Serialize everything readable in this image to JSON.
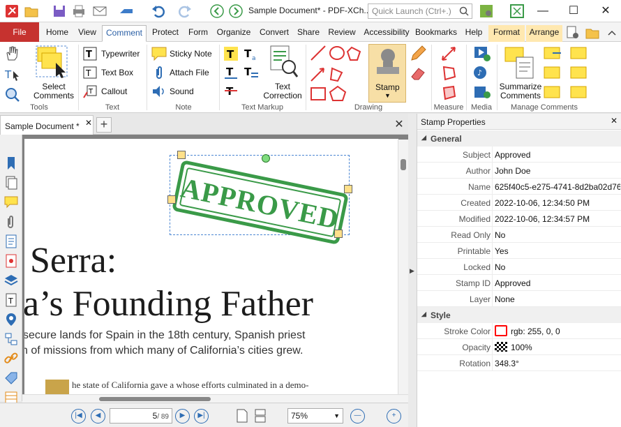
{
  "window": {
    "title": "Sample Document* - PDF-XCh...",
    "quick_launch_placeholder": "Quick Launch (Ctrl+.)"
  },
  "tabs": [
    {
      "label": "File"
    },
    {
      "label": "Home"
    },
    {
      "label": "View"
    },
    {
      "label": "Comment"
    },
    {
      "label": "Protect"
    },
    {
      "label": "Form"
    },
    {
      "label": "Organize"
    },
    {
      "label": "Convert"
    },
    {
      "label": "Share"
    },
    {
      "label": "Review"
    },
    {
      "label": "Accessibility"
    },
    {
      "label": "Bookmarks"
    },
    {
      "label": "Help"
    },
    {
      "label": "Format"
    },
    {
      "label": "Arrange"
    }
  ],
  "ribbon": {
    "tools": {
      "select_line1": "Select",
      "select_line2": "Comments",
      "group": "Tools"
    },
    "text": {
      "typewriter": "Typewriter",
      "text_box": "Text Box",
      "callout": "Callout",
      "group": "Text"
    },
    "note": {
      "sticky_note": "Sticky Note",
      "attach_file": "Attach File",
      "sound": "Sound",
      "group": "Note"
    },
    "markup": {
      "correction_line1": "Text",
      "correction_line2": "Correction",
      "group": "Text Markup"
    },
    "drawing": {
      "stamp": "Stamp",
      "group": "Drawing"
    },
    "measure": {
      "group": "Measure"
    },
    "media": {
      "group": "Media"
    },
    "manage": {
      "summarize_line1": "Summarize",
      "summarize_line2": "Comments",
      "group": "Manage Comments"
    }
  },
  "document_tab": {
    "label": "Sample Document *"
  },
  "document": {
    "heading1": "Serra:",
    "heading2": "a’s Founding Father",
    "sub1": "secure lands for Spain in the 18th century, Spanish priest",
    "sub2": "n of missions from which many of California’s cities grew.",
    "body": "he state of California gave a    whose efforts culminated in a demo-",
    "stamp_text": "APPROVED"
  },
  "navigation": {
    "page_current": "5",
    "page_total": "/ 89",
    "zoom": "75%"
  },
  "properties": {
    "title": "Stamp Properties",
    "general_label": "General",
    "style_label": "Style",
    "general": [
      {
        "key": "Subject",
        "value": "Approved"
      },
      {
        "key": "Author",
        "value": "John Doe"
      },
      {
        "key": "Name",
        "value": "625f40c5-e275-4741-8d2ba02d76..."
      },
      {
        "key": "Created",
        "value": "2022-10-06, 12:34:50 PM"
      },
      {
        "key": "Modified",
        "value": "2022-10-06, 12:34:57 PM"
      },
      {
        "key": "Read Only",
        "value": "No"
      },
      {
        "key": "Printable",
        "value": "Yes"
      },
      {
        "key": "Locked",
        "value": "No"
      },
      {
        "key": "Stamp ID",
        "value": "Approved"
      },
      {
        "key": "Layer",
        "value": "None"
      }
    ],
    "style": [
      {
        "key": "Stroke Color",
        "value": "rgb: 255, 0, 0"
      },
      {
        "key": "Opacity",
        "value": "100%"
      },
      {
        "key": "Rotation",
        "value": "348.3°"
      }
    ]
  },
  "colors": {
    "accent": "#2e6db4",
    "file_tab": "#c6322f",
    "stamp_green": "#3a9a48",
    "stroke": "#ff0000"
  },
  "icons": [
    "app-logo-icon",
    "open-folder-icon",
    "save-icon",
    "print-icon",
    "email-icon",
    "scan-icon",
    "undo-icon",
    "redo-icon",
    "back-icon",
    "forward-icon",
    "search-icon",
    "hand-icon",
    "select-text-icon",
    "zoom-icon",
    "stamp-icon",
    "eraser-icon",
    "pencil-icon"
  ]
}
